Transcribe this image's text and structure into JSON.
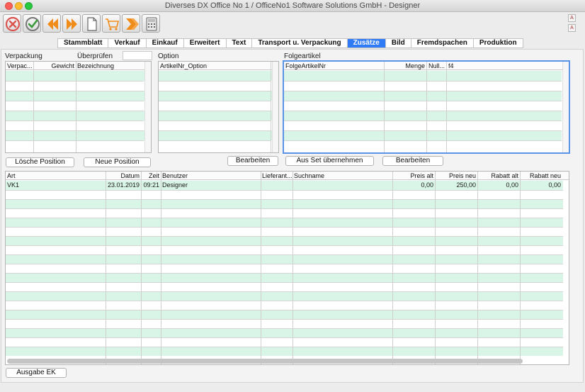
{
  "window": {
    "title": "Diverses DX Office No 1 /  OfficeNo1 Software Solutions GmbH - Designer"
  },
  "toolbar": {
    "buttons": [
      {
        "name": "cancel-icon",
        "color": "#d9534f"
      },
      {
        "name": "checkmark-icon",
        "color": "#3c9a3c"
      },
      {
        "name": "arrow-left-icon",
        "color": "#f08c1a"
      },
      {
        "name": "arrow-right-icon",
        "color": "#f08c1a"
      },
      {
        "name": "document-icon",
        "color": "#666666"
      },
      {
        "name": "cart-icon",
        "color": "#f08c1a"
      },
      {
        "name": "double-arrow-right-icon",
        "color": "#f08c1a"
      },
      {
        "name": "calculator-icon",
        "color": "#666666"
      }
    ]
  },
  "tabs": [
    {
      "label": "Stammblatt",
      "active": false
    },
    {
      "label": "Verkauf",
      "active": false
    },
    {
      "label": "Einkauf",
      "active": false
    },
    {
      "label": "Erweitert",
      "active": false
    },
    {
      "label": "Text",
      "active": false
    },
    {
      "label": "Transport u. Verpackung",
      "active": false
    },
    {
      "label": "Zusätze",
      "active": true
    },
    {
      "label": "Bild",
      "active": false
    },
    {
      "label": "Fremdspachen",
      "active": false
    },
    {
      "label": "Produktion",
      "active": false
    }
  ],
  "verpackung": {
    "title": "Verpackung",
    "ueberpruefen_label": "Überprüfen",
    "ueberpruefen_value": "",
    "columns": [
      "Verpac...",
      "Gewicht",
      "Bezeichnung"
    ],
    "rows": []
  },
  "option": {
    "title": "Option",
    "columns": [
      "ArtikelNr_Option"
    ],
    "rows": []
  },
  "folgeartikel": {
    "title": "Folgeartikel",
    "columns": [
      "FolgeArtikelNr",
      "Menge",
      "Null...",
      "f4"
    ],
    "rows": []
  },
  "buttons": {
    "loesche_position": "Lösche Position",
    "neue_position": "Neue Position",
    "bearbeiten_option": "Bearbeiten",
    "aus_set": "Aus Set übernehmen",
    "bearbeiten_folge": "Bearbeiten",
    "ausgabe_ek": "Ausgabe EK"
  },
  "history": {
    "columns": [
      "Art",
      "Datum",
      "Zeit",
      "Benutzer",
      "Lieferant...",
      "Suchname",
      "Preis alt",
      "Preis neu",
      "Rabatt alt",
      "Rabatt neu"
    ],
    "rows": [
      {
        "art": "VK1",
        "datum": "23.01.2019",
        "zeit": "09:21",
        "benutzer": "Designer",
        "lieferant": "",
        "suchname": "",
        "preis_alt": "0,00",
        "preis_neu": "250,00",
        "rabatt_alt": "0,00",
        "rabatt_neu": "0,00"
      }
    ]
  },
  "colors": {
    "accent": "#2f7bf5",
    "row_band": "#d9f5e7",
    "focus_border": "#5b93e6"
  }
}
